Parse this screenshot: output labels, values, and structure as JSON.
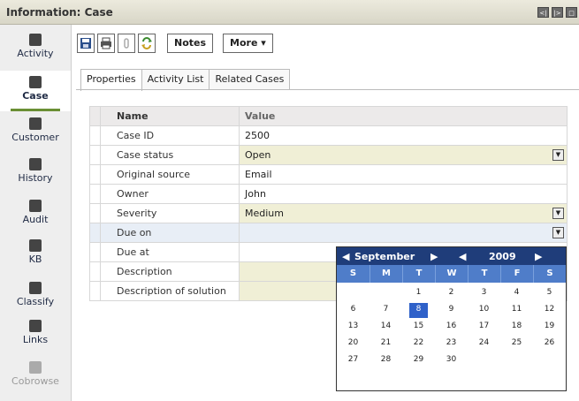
{
  "window": {
    "title": "Information: Case",
    "controls": [
      "<|",
      "|>",
      "□"
    ]
  },
  "sidebar": {
    "items": [
      {
        "label": "Activity",
        "icon": "activity-icon",
        "active": false,
        "disabled": false
      },
      {
        "label": "Case",
        "icon": "case-icon",
        "active": true,
        "disabled": false
      },
      {
        "label": "Customer",
        "icon": "customer-icon",
        "active": false,
        "disabled": false
      },
      {
        "label": "History",
        "icon": "history-icon",
        "active": false,
        "disabled": false
      },
      {
        "label": "Audit",
        "icon": "audit-icon",
        "active": false,
        "disabled": false
      },
      {
        "label": "KB",
        "icon": "kb-icon",
        "active": false,
        "disabled": false
      },
      {
        "label": "Classify",
        "icon": "classify-icon",
        "active": false,
        "disabled": false
      },
      {
        "label": "Links",
        "icon": "links-icon",
        "active": false,
        "disabled": false
      },
      {
        "label": "Cobrowse",
        "icon": "cobrowse-icon",
        "active": false,
        "disabled": true
      }
    ]
  },
  "toolbar": {
    "notes_label": "Notes",
    "more_label": "More ▾"
  },
  "tabs": [
    "Properties",
    "Activity List",
    "Related Cases"
  ],
  "table": {
    "headers": [
      "Name",
      "Value"
    ],
    "rows": [
      {
        "name": "Case ID",
        "value": "2500"
      },
      {
        "name": "Case status",
        "value": "Open"
      },
      {
        "name": "Original source",
        "value": "Email"
      },
      {
        "name": "Owner",
        "value": "John"
      },
      {
        "name": "Severity",
        "value": "Medium"
      },
      {
        "name": "Due on",
        "value": ""
      },
      {
        "name": "Due at",
        "value": ""
      },
      {
        "name": "Description",
        "value": ""
      },
      {
        "name": "Description of solution",
        "value": ""
      }
    ]
  },
  "calendar": {
    "month": "September",
    "year": "2009",
    "weekdays": [
      "S",
      "M",
      "T",
      "W",
      "T",
      "F",
      "S"
    ],
    "days": [
      "",
      "",
      "1",
      "2",
      "3",
      "4",
      "5",
      "6",
      "7",
      "8",
      "9",
      "10",
      "11",
      "12",
      "13",
      "14",
      "15",
      "16",
      "17",
      "18",
      "19",
      "20",
      "21",
      "22",
      "23",
      "24",
      "25",
      "26",
      "27",
      "28",
      "29",
      "30"
    ],
    "selected_day": "8"
  }
}
